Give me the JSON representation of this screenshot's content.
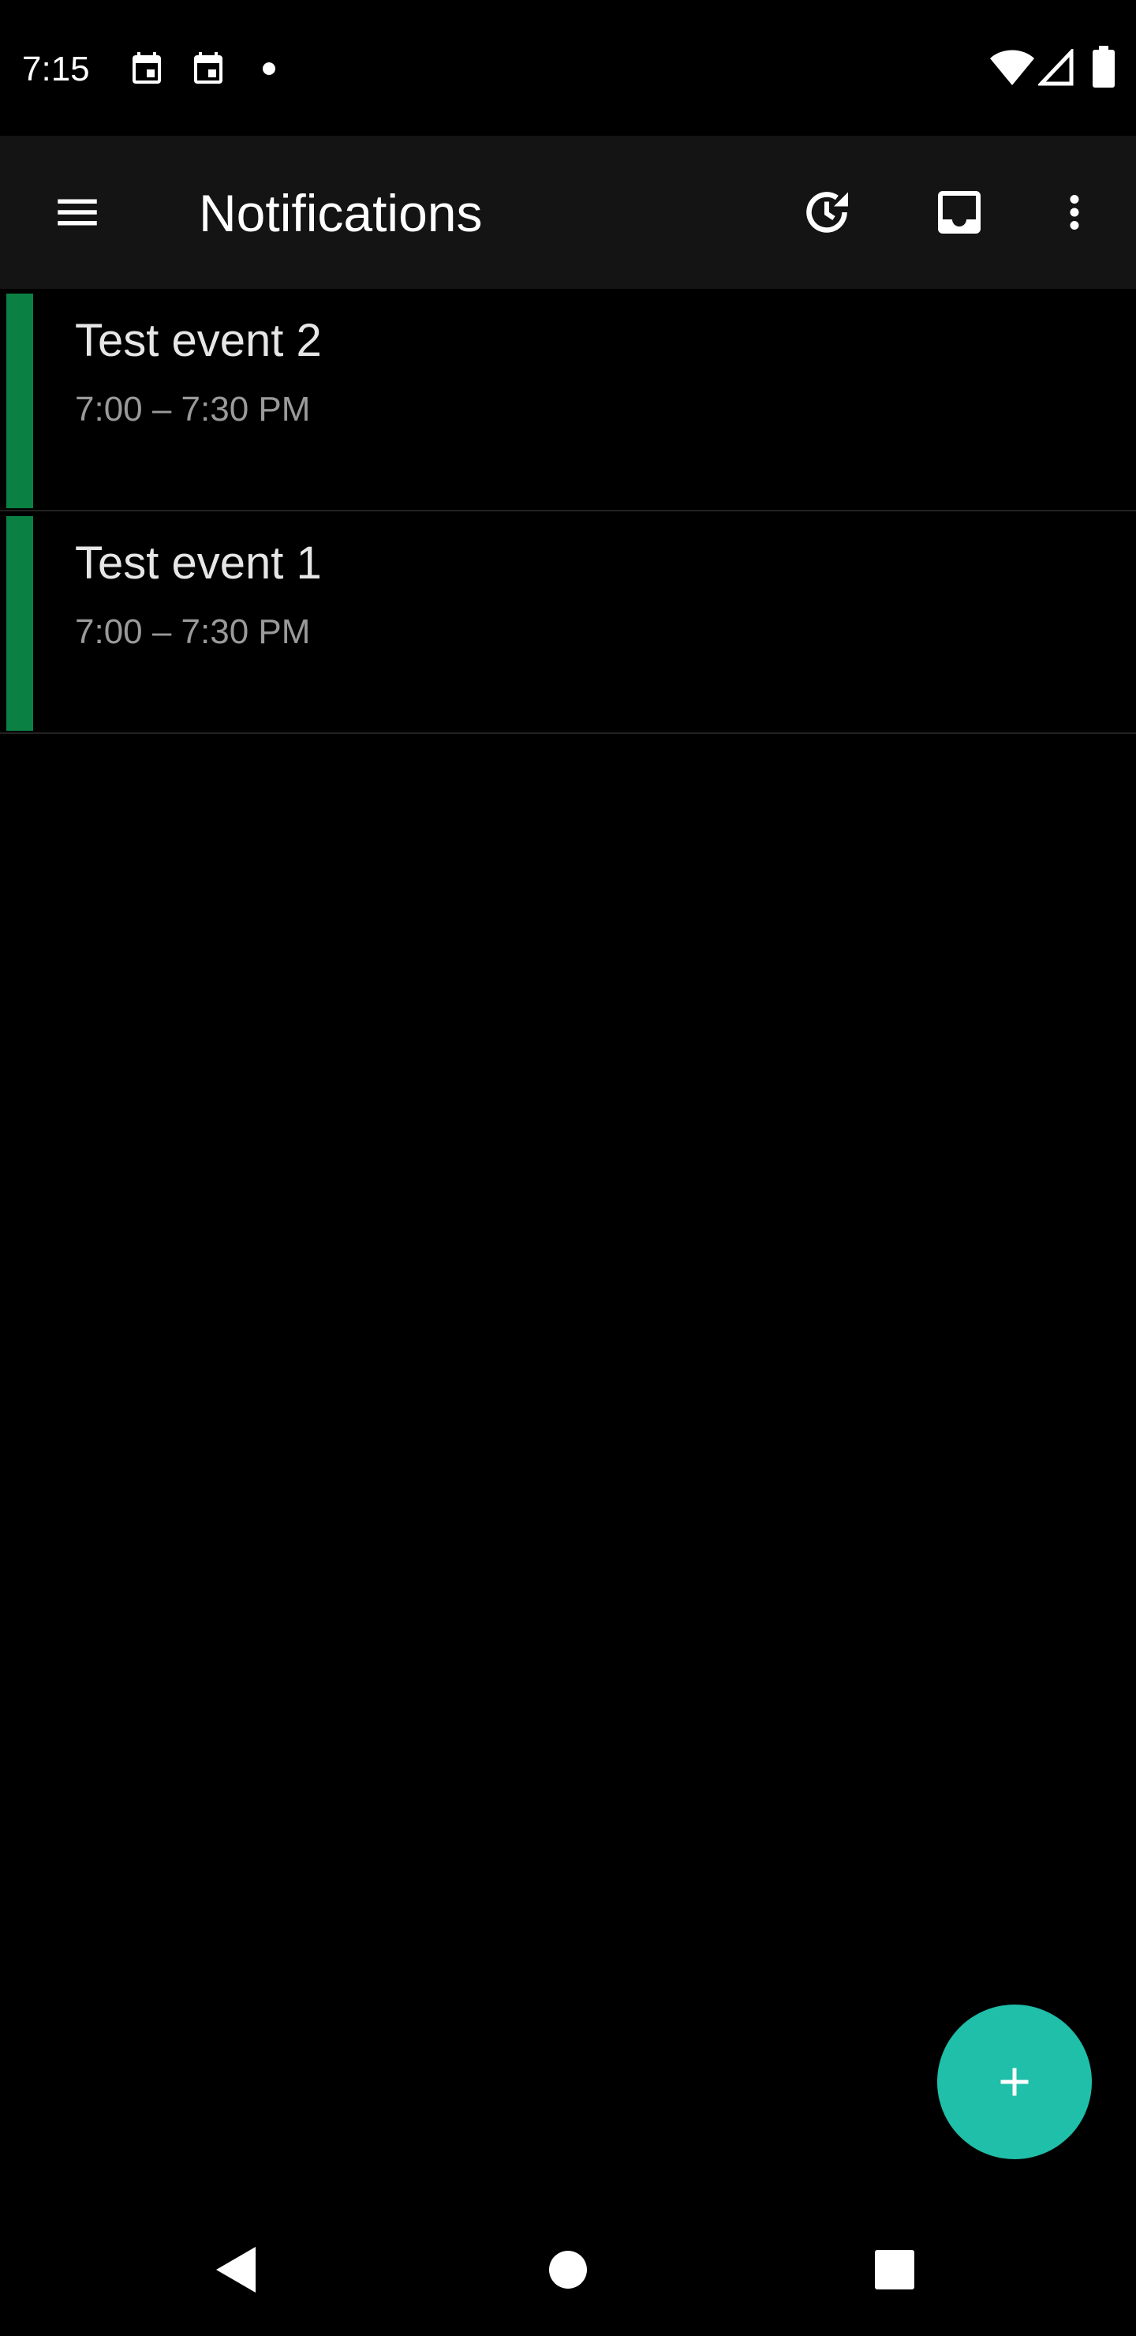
{
  "status_bar": {
    "time": "7:15",
    "left_icons": [
      "calendar-icon",
      "calendar-icon",
      "notification-dot-icon"
    ],
    "right_icons": [
      "wifi-icon",
      "cell-signal-icon",
      "battery-icon"
    ]
  },
  "app_bar": {
    "title": "Notifications",
    "actions": [
      "menu-icon",
      "snooze-all-icon",
      "inbox-icon",
      "more-vert-icon"
    ]
  },
  "events": [
    {
      "title": "Test event 2",
      "time": "7:00 – 7:30 PM",
      "color": "#0b8043"
    },
    {
      "title": "Test event 1",
      "time": "7:00 – 7:30 PM",
      "color": "#0b8043"
    }
  ],
  "fab": {
    "icon": "add-icon",
    "color": "#1fbfa9"
  },
  "nav_bar": {
    "buttons": [
      "back-icon",
      "home-icon",
      "recents-icon"
    ]
  },
  "colors": {
    "background": "#000000",
    "app_bar": "#141414",
    "title_text": "#e6e6e6",
    "secondary_text": "#9a9a9a"
  }
}
